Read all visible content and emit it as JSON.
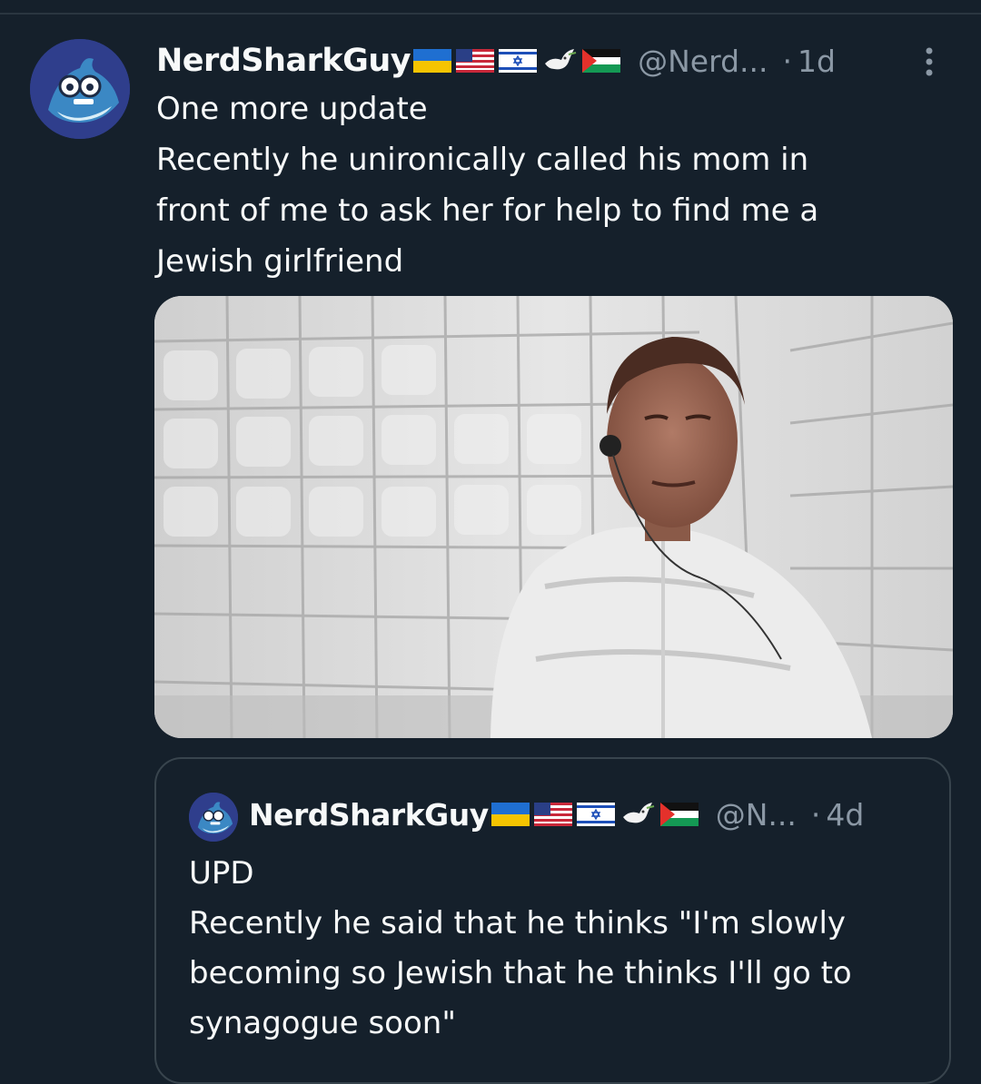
{
  "post": {
    "display_name": "NerdSharkGuy",
    "flags": [
      "ukraine-flag",
      "usa-flag",
      "israel-flag",
      "dove-emoji",
      "palestine-flag"
    ],
    "handle": "@Nerd...",
    "separator": "·",
    "time": "1d",
    "text_lines": [
      "One more update",
      "Recently he unironically called his mom in",
      "front of me to ask her for help to find me a",
      "Jewish girlfriend"
    ],
    "media_icon": "gif-man-in-padded-room"
  },
  "quote": {
    "display_name": "NerdSharkGuy",
    "flags": [
      "ukraine-flag",
      "usa-flag",
      "israel-flag",
      "dove-emoji",
      "palestine-flag"
    ],
    "handle": "@N...",
    "separator": "·",
    "time": "4d",
    "text_lines": [
      "UPD",
      "Recently he said that he thinks \"I'm slowly",
      "becoming so Jewish that he thinks I'll go to",
      "synagogue soon\""
    ]
  },
  "colors": {
    "background": "#15202b",
    "text_primary": "#f7f9f9",
    "text_secondary": "#8b98a5",
    "border": "#38444d"
  }
}
